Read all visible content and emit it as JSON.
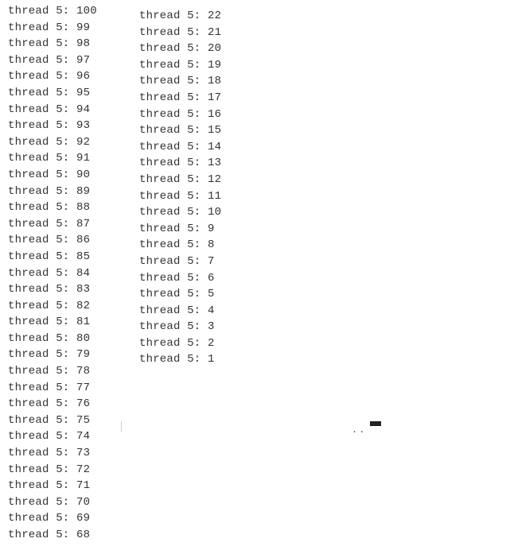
{
  "columns": {
    "left": [
      "thread 5: 100",
      "thread 5: 99",
      "thread 5: 98",
      "thread 5: 97",
      "thread 5: 96",
      "thread 5: 95",
      "thread 5: 94",
      "thread 5: 93",
      "thread 5: 92",
      "thread 5: 91",
      "thread 5: 90",
      "thread 5: 89",
      "thread 5: 88",
      "thread 5: 87",
      "thread 5: 86",
      "thread 5: 85",
      "thread 5: 84",
      "thread 5: 83",
      "thread 5: 82",
      "thread 5: 81",
      "thread 5: 80",
      "thread 5: 79",
      "thread 5: 78",
      "thread 5: 77",
      "thread 5: 76",
      "thread 5: 75",
      "thread 5: 74",
      "thread 5: 73",
      "thread 5: 72",
      "thread 5: 71",
      "thread 5: 70",
      "thread 5: 69",
      "thread 5: 68"
    ],
    "right": [
      "thread 5: 22",
      "thread 5: 21",
      "thread 5: 20",
      "thread 5: 19",
      "thread 5: 18",
      "thread 5: 17",
      "thread 5: 16",
      "thread 5: 15",
      "thread 5: 14",
      "thread 5: 13",
      "thread 5: 12",
      "thread 5: 11",
      "thread 5: 10",
      "thread 5: 9",
      "thread 5: 8",
      "thread 5: 7",
      "thread 5: 6",
      "thread 5: 5",
      "thread 5: 4",
      "thread 5: 3",
      "thread 5: 2",
      "thread 5: 1"
    ]
  }
}
